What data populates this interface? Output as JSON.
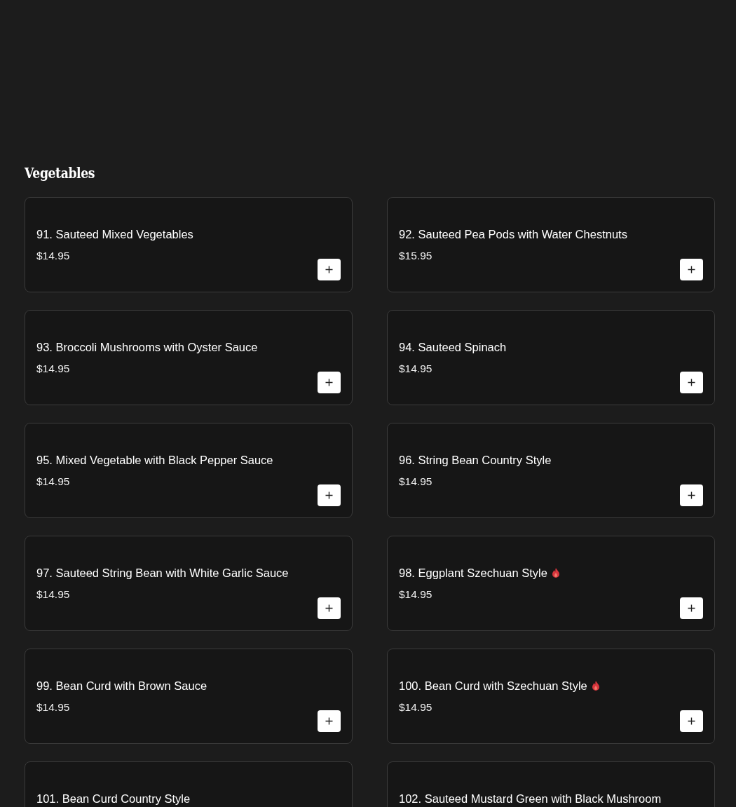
{
  "section": {
    "title": "Vegetables"
  },
  "items": [
    {
      "name": "91. Sauteed Mixed Vegetables",
      "price": "$14.95",
      "spicy": false
    },
    {
      "name": "92. Sauteed Pea Pods with Water Chestnuts",
      "price": "$15.95",
      "spicy": false
    },
    {
      "name": "93. Broccoli Mushrooms with Oyster Sauce",
      "price": "$14.95",
      "spicy": false
    },
    {
      "name": "94. Sauteed Spinach",
      "price": "$14.95",
      "spicy": false
    },
    {
      "name": "95. Mixed Vegetable with Black Pepper Sauce",
      "price": "$14.95",
      "spicy": false
    },
    {
      "name": "96. String Bean Country Style",
      "price": "$14.95",
      "spicy": false
    },
    {
      "name": "97. Sauteed String Bean with White Garlic Sauce",
      "price": "$14.95",
      "spicy": false
    },
    {
      "name": "98. Eggplant Szechuan Style",
      "price": "$14.95",
      "spicy": true
    },
    {
      "name": "99. Bean Curd with Brown Sauce",
      "price": "$14.95",
      "spicy": false
    },
    {
      "name": "100. Bean Curd with Szechuan Style",
      "price": "$14.95",
      "spicy": true
    },
    {
      "name": "101. Bean Curd Country Style",
      "spicy": false
    },
    {
      "name": "102. Sauteed Mustard Green with Black Mushroom",
      "spicy": false
    }
  ]
}
